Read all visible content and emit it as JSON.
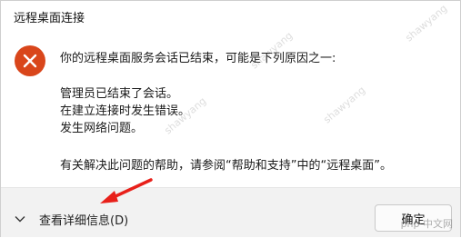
{
  "window": {
    "title": "远程桌面连接"
  },
  "icon": {
    "name": "error-icon",
    "color": "#d9461b"
  },
  "message": {
    "lines": [
      "你的远程桌面服务会话已结束，可能是下列原因之一:",
      "管理员已结束了会话。",
      "在建立连接时发生错误。",
      "发生网络问题。",
      "有关解决此问题的帮助，请参阅“帮助和支持”中的“远程桌面”。"
    ]
  },
  "footer": {
    "details_label": "查看详细信息(D)",
    "ok_label": "确定"
  },
  "annotation": {
    "arrow_color": "#e8201a"
  },
  "watermark": {
    "text": "shawyang",
    "overlay": "php 中文网"
  }
}
